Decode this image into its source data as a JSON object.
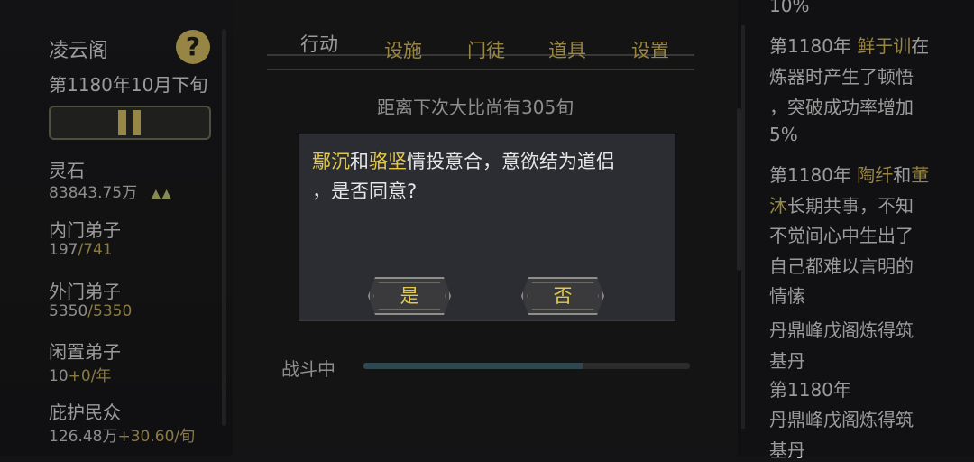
{
  "left": {
    "sect_name": "凌云阁",
    "help": "?",
    "date": "第1180年10月下旬",
    "stats": [
      {
        "label": "灵石",
        "value": "83843.75万",
        "trend": "▲▲"
      },
      {
        "label": "内门弟子",
        "current": "197",
        "sep": "/",
        "max": "741"
      },
      {
        "label": "外门弟子",
        "current": "5350",
        "sep": "/",
        "max": "5350"
      },
      {
        "label": "闲置弟子",
        "base": "10",
        "delta": "+0/年"
      },
      {
        "label": "庇护民众",
        "base": "126.48万",
        "delta": "+30.60/旬"
      }
    ]
  },
  "center": {
    "tabs": [
      "行动",
      "设施",
      "门徒",
      "道具",
      "设置"
    ],
    "countdown": "距离下次大比尚有305旬",
    "fight_label": "战斗中",
    "progress": 0.67
  },
  "right": {
    "lines": [
      {
        "segs": [
          {
            "t": "10%"
          }
        ]
      },
      {
        "segs": [
          {
            "t": "第1180年 "
          },
          {
            "t": "鲜于训",
            "c": "gold"
          },
          {
            "t": "在"
          }
        ]
      },
      {
        "segs": [
          {
            "t": "炼器时产生了顿悟"
          }
        ]
      },
      {
        "segs": [
          {
            "t": "，突破成功率增加"
          }
        ]
      },
      {
        "segs": [
          {
            "t": "5%"
          }
        ]
      },
      {
        "segs": [
          {
            "t": "第1180年 "
          },
          {
            "t": "陶纤",
            "c": "gold"
          },
          {
            "t": "和"
          },
          {
            "t": "董",
            "c": "gold"
          }
        ]
      },
      {
        "segs": [
          {
            "t": "沐",
            "c": "gold"
          },
          {
            "t": "长期共事，不知"
          }
        ]
      },
      {
        "segs": [
          {
            "t": "不觉间心中生出了"
          }
        ]
      },
      {
        "segs": [
          {
            "t": "自己都难以言明的"
          }
        ]
      },
      {
        "segs": [
          {
            "t": "情愫"
          }
        ]
      },
      {
        "segs": [
          {
            "t": "丹鼎峰戊阁炼得筑"
          }
        ]
      },
      {
        "segs": [
          {
            "t": "基丹"
          }
        ]
      },
      {
        "segs": [
          {
            "t": "第1180年"
          }
        ]
      },
      {
        "segs": [
          {
            "t": "丹鼎峰戊阁炼得筑"
          }
        ]
      },
      {
        "segs": [
          {
            "t": "基丹"
          }
        ]
      }
    ]
  },
  "modal": {
    "name1": "鄢沉",
    "and": "和",
    "name2": "骆坚",
    "text1": "情投意合，意欲结为道侣",
    "text2": "，是否同意?",
    "yes": "是",
    "no": "否"
  }
}
